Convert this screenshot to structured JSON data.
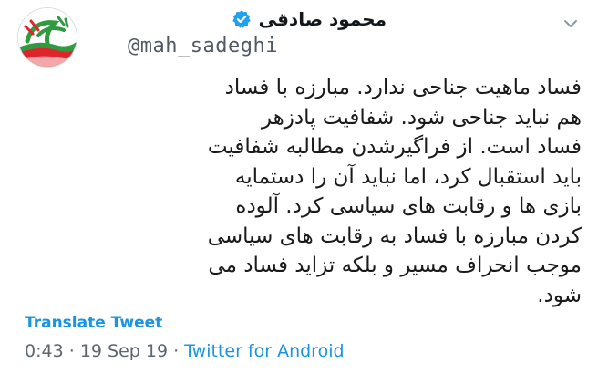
{
  "author": {
    "display_name": "محمود صادقی",
    "handle": "@mah_sadeghi",
    "verified": true,
    "avatar_icon": "avatar-logo-icon"
  },
  "tweet": {
    "lines": [
      "فساد ماهیت جناحی ندارد. مبارزه با فساد",
      "هم نباید جناحی شود. شفافیت پادزهر",
      "فساد است. از فراگیرشدن مطالبه شفافیت",
      "باید استقبال کرد، اما نباید آن را دستمایه",
      "بازی ها و رقابت های سیاسی کرد. آلوده",
      "کردن مبارزه با فساد به رقابت های سیاسی",
      "موجب انحراف مسیر و بلکه تزاید فساد می",
      "شود."
    ],
    "translate_label": "Translate Tweet",
    "time": "0:43",
    "date": "19 Sep 19",
    "separator": "·",
    "source": "Twitter for Android"
  },
  "colors": {
    "link": "#1b95e0",
    "verified": "#1da1f2",
    "meta": "#5c6670"
  }
}
